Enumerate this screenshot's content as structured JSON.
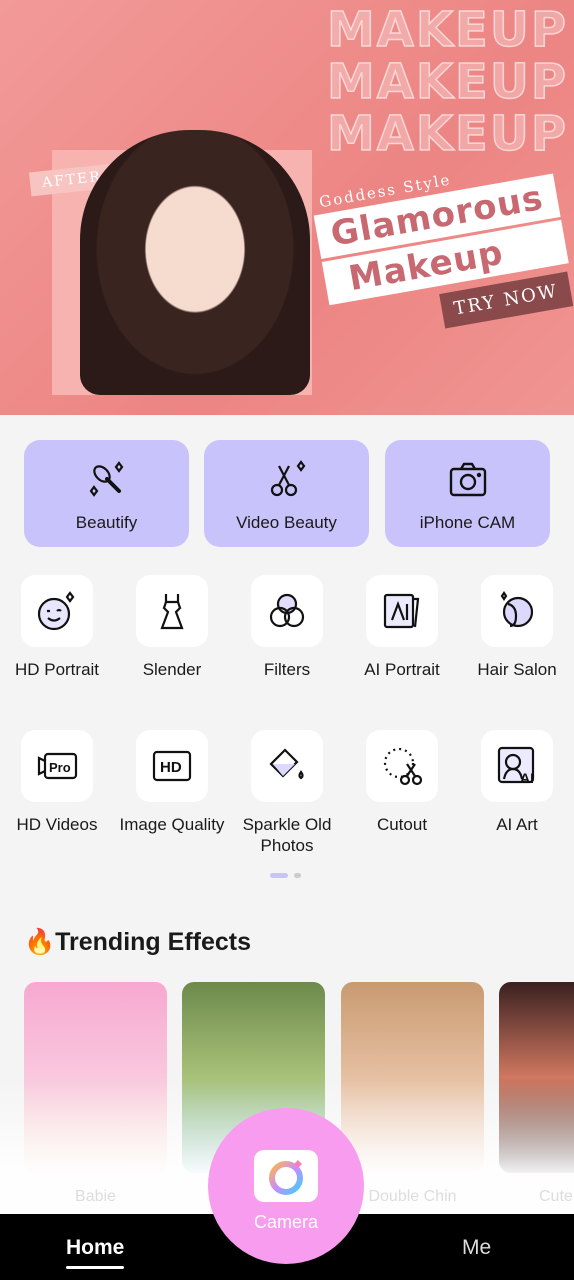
{
  "banner": {
    "watermark": "MAKEUP",
    "after": "AFTER",
    "subtitle": "Goddess Style",
    "title_line1": "Glamorous",
    "title_line2": "Makeup",
    "cta": "TRY NOW"
  },
  "main_features": [
    {
      "label": "Beautify",
      "icon": "makeup-brush-icon"
    },
    {
      "label": "Video Beauty",
      "icon": "scissors-icon"
    },
    {
      "label": "iPhone CAM",
      "icon": "camera-icon"
    }
  ],
  "tools": [
    {
      "label": "HD Portrait",
      "icon": "wink-face-icon"
    },
    {
      "label": "Slender",
      "icon": "dress-icon"
    },
    {
      "label": "Filters",
      "icon": "filters-icon"
    },
    {
      "label": "AI Portrait",
      "icon": "ai-portrait-icon"
    },
    {
      "label": "Hair Salon",
      "icon": "hair-icon"
    },
    {
      "label": "HD Videos",
      "icon": "pro-video-icon"
    },
    {
      "label": "Image Quality",
      "icon": "hd-icon"
    },
    {
      "label": "Sparkle Old Photos",
      "icon": "paint-bucket-icon"
    },
    {
      "label": "Cutout",
      "icon": "cutout-icon"
    },
    {
      "label": "AI Art",
      "icon": "ai-art-icon"
    }
  ],
  "pagination": {
    "pages": 2,
    "current": 1
  },
  "trending": {
    "title": "Trending Effects",
    "emoji": "🔥",
    "items": [
      {
        "label": "Babie"
      },
      {
        "label": ""
      },
      {
        "label": "Double Chin"
      },
      {
        "label": "Cute"
      }
    ]
  },
  "nav": {
    "home": "Home",
    "camera": "Camera",
    "me": "Me"
  },
  "colors": {
    "banner": "#ec8583",
    "feature_card": "#c8c4fb",
    "camera_button": "#f89cef",
    "nav_bg": "#000000"
  }
}
